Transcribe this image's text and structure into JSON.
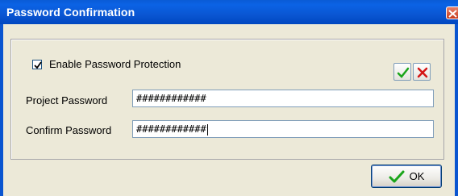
{
  "window": {
    "title": "Password Confirmation"
  },
  "options": {
    "enable_protection_label": "Enable Password Protection",
    "enable_protection_checked": true
  },
  "fields": {
    "project_password": {
      "label": "Project Password",
      "value": "############"
    },
    "confirm_password": {
      "label": "Confirm Password",
      "value": "############"
    }
  },
  "buttons": {
    "ok_label": "OK",
    "accept_icon": "green-check-icon",
    "reject_icon": "red-x-icon"
  },
  "colors": {
    "titlebar": "#0a5bd6",
    "accept": "#1aa51a",
    "reject": "#d41414",
    "dialog_bg": "#ece9d8"
  }
}
